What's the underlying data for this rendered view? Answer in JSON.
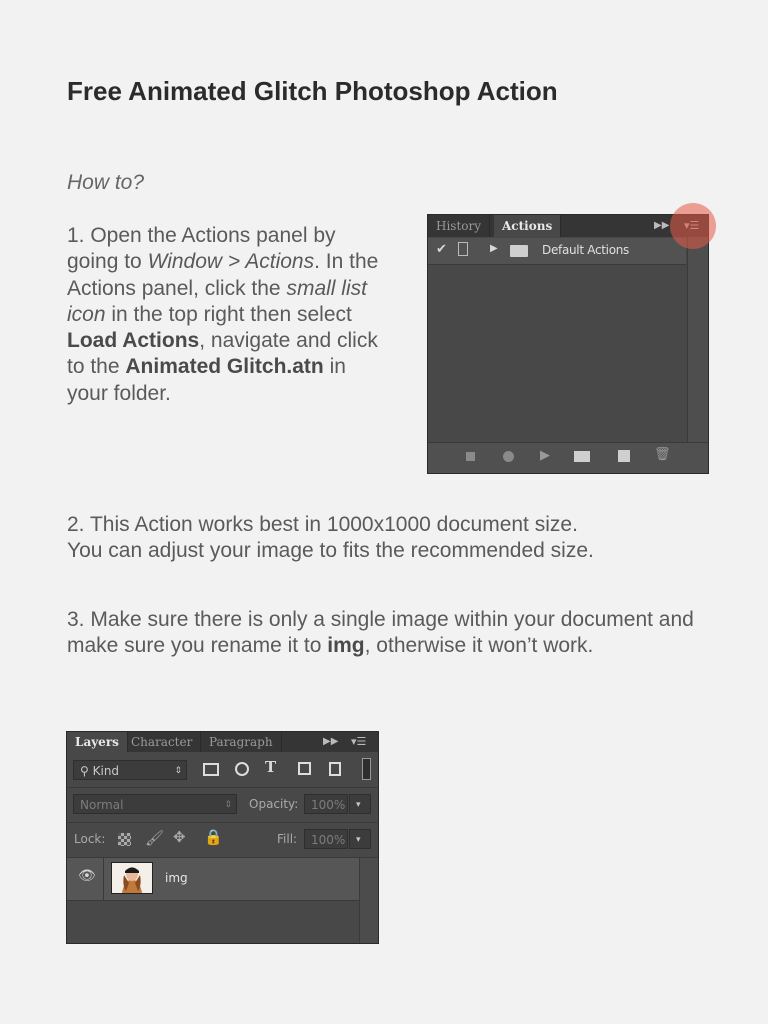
{
  "title": "Free Animated Glitch Photoshop Action",
  "howto": "How to?",
  "step1": {
    "t1": "1. Open the Actions panel by going to ",
    "i1": "Window > Actions",
    "t2": ". In the Actions panel, click the ",
    "i2": "small list icon",
    "t3": " in the top right then select ",
    "b1": "Load Actions",
    "t4": ", navigate and click to the ",
    "b2": "Animated Glitch.atn",
    "t5": " in your folder."
  },
  "step2": {
    "line1": "2. This Action works best in 1000x1000 document size.",
    "line2": "You can adjust your image to fits the recommended size."
  },
  "step3": {
    "t1": "3. Make sure there is only a single image within your document and make sure you rename it to ",
    "b1": "img",
    "t2": ", otherwise it won’t work."
  },
  "actions_panel": {
    "tabs": [
      "History",
      "Actions"
    ],
    "row_label": "Default Actions",
    "icons": [
      "collapse-icon",
      "panel-menu-icon",
      "checkmark-icon",
      "toggle-dialog-icon",
      "expand-triangle-icon",
      "folder-icon",
      "stop-icon",
      "record-icon",
      "play-icon",
      "new-set-icon",
      "new-action-icon",
      "trash-icon"
    ]
  },
  "layers_panel": {
    "tabs": [
      "Layers",
      "Character",
      "Paragraph"
    ],
    "filter_value": "Kind",
    "blend_mode": "Normal",
    "opacity_label": "Opacity:",
    "opacity_value": "100%",
    "lock_label": "Lock:",
    "fill_label": "Fill:",
    "fill_value": "100%",
    "layer_name": "img"
  },
  "colors": {
    "highlight": "#e65a46",
    "panel_bg": "#484848",
    "page_bg": "#f2f2f2"
  }
}
